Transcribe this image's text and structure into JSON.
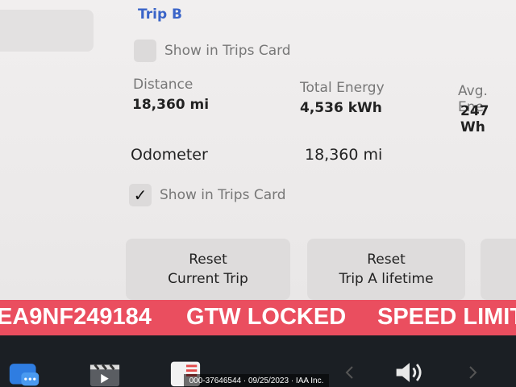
{
  "trip": {
    "title": "Trip B",
    "show_in_trips_card_label": "Show in Trips Card",
    "show_checked": false,
    "stats": {
      "distance": {
        "label": "Distance",
        "value": "18,360 mi"
      },
      "total_energy": {
        "label": "Total Energy",
        "value": "4,536 kWh"
      },
      "avg_energy": {
        "label": "Avg. Ene",
        "value": "247 Wh"
      }
    }
  },
  "odometer": {
    "label": "Odometer",
    "value": "18,360 mi",
    "show_in_trips_card_label": "Show in Trips Card",
    "show_checked": true,
    "check_mark": "✓"
  },
  "buttons": {
    "reset_current": {
      "line1": "Reset",
      "line2": "Current Trip"
    },
    "reset_trip_a": {
      "line1": "Reset",
      "line2": "Trip A lifetime"
    }
  },
  "alert_bar": {
    "vin_fragment": "EA9NF249184",
    "gtw_locked": "GTW LOCKED",
    "speed_limit": "SPEED LIMIT",
    "color": "#ea4e5f"
  },
  "dock": {
    "icons": [
      "chat-icon",
      "video-icon",
      "notes-icon",
      "chevron-left-icon",
      "volume-icon",
      "chevron-right-icon"
    ]
  },
  "watermark": {
    "text": "000-37646544 · 09/25/2023 · IAA Inc."
  },
  "colors": {
    "accent": "#3a64c8"
  }
}
